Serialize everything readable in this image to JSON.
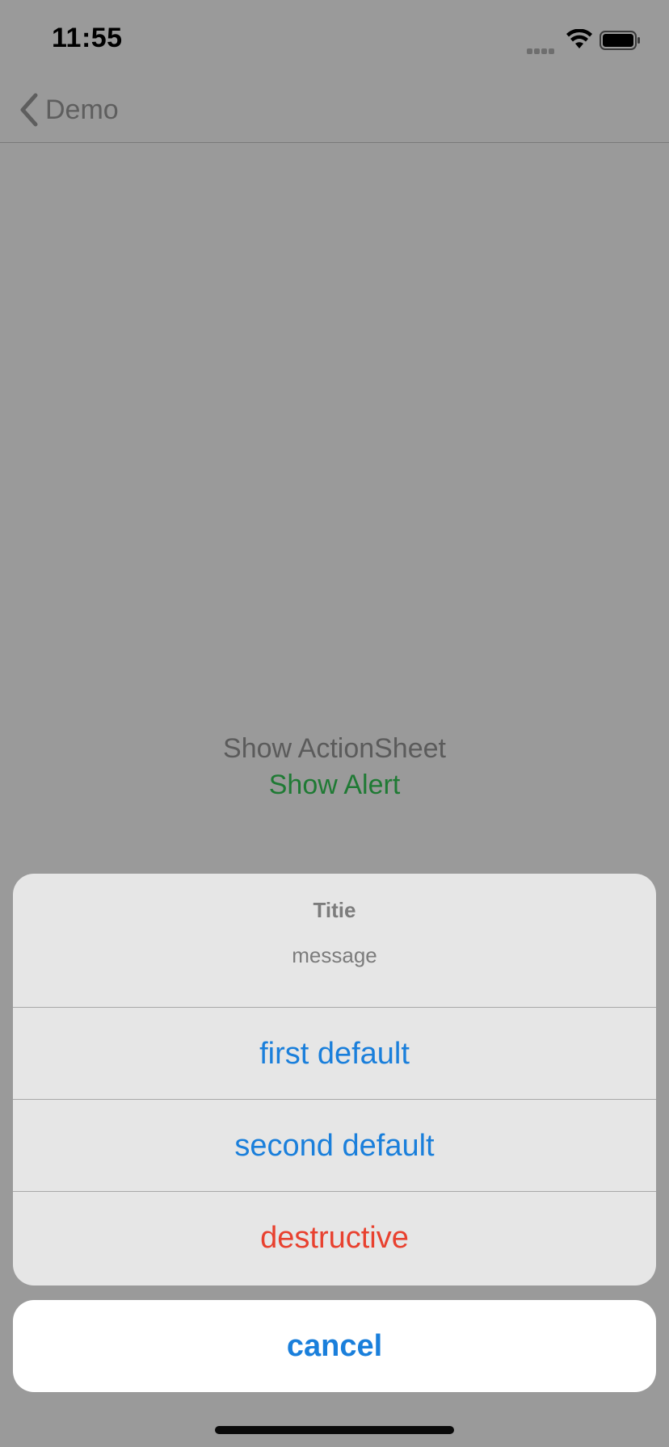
{
  "status_bar": {
    "time": "11:55",
    "icons": [
      "signal-icon",
      "wifi-icon",
      "battery-icon"
    ]
  },
  "nav": {
    "back_label": "Demo",
    "back_icon": "chevron-left-icon"
  },
  "main": {
    "show_actionsheet_label": "Show ActionSheet",
    "show_alert_label": "Show Alert"
  },
  "action_sheet": {
    "title": "Titie",
    "message": "message",
    "actions": [
      {
        "label": "first default",
        "style": "default"
      },
      {
        "label": "second default",
        "style": "default"
      },
      {
        "label": "destructive",
        "style": "destructive"
      }
    ],
    "cancel_label": "cancel"
  },
  "colors": {
    "dim_background": "#9a9a9a",
    "sheet_background": "#e6e6e6",
    "action_blue": "#1a7fdb",
    "destructive_red": "#e8412f",
    "alert_green": "#1f7a34"
  }
}
